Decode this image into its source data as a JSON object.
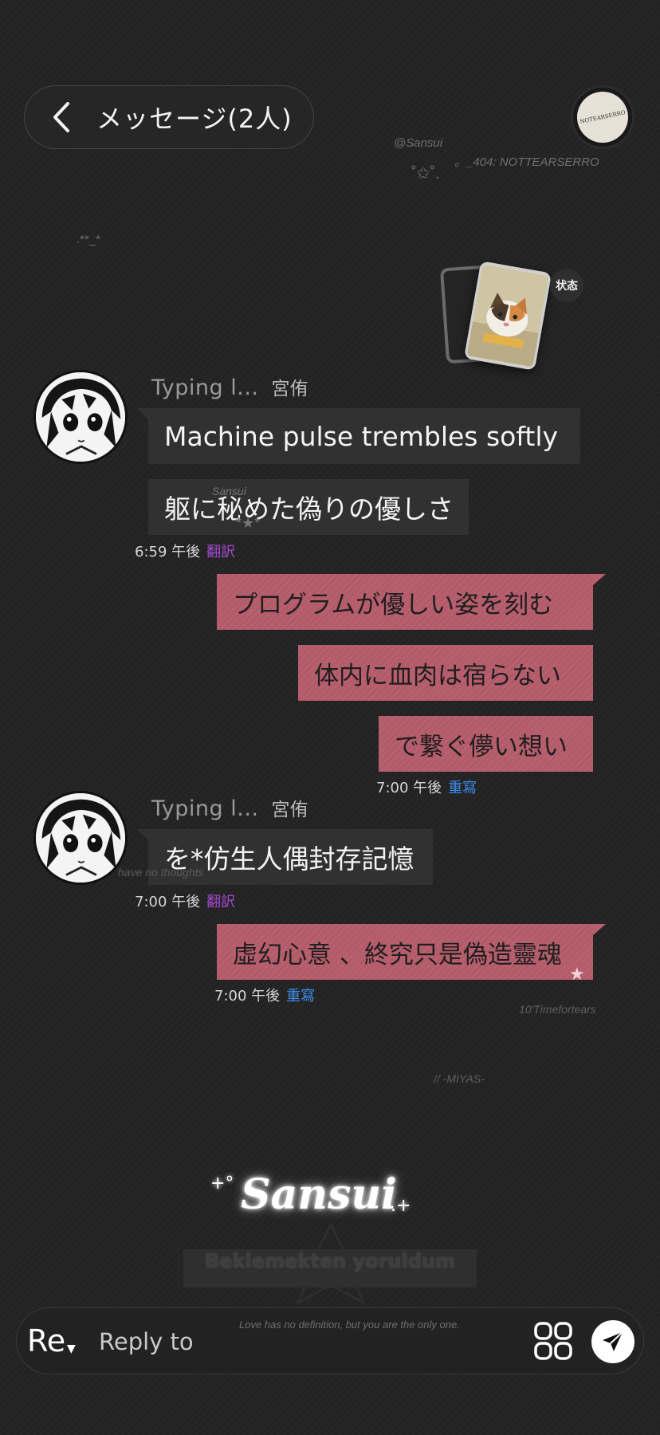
{
  "header": {
    "title": "メッセージ(2人)",
    "avatar_text": "NOTEARSERRO"
  },
  "decorations": {
    "handle_top": "@Sansui",
    "tag_top": "。_404:  NOTTEARSERRO",
    "sparkle_top": "˚✩˚.",
    "dots_left": ".**_*",
    "watermark_mid": "Sansui",
    "watermark_mid_stars": "*★*",
    "have_no_thoughts": "have no thoughts",
    "timeforte": "10'Timefortears",
    "miyas": "//   -MIYAS-"
  },
  "status": {
    "label": "状态"
  },
  "groups": [
    {
      "nickname": "Typing l...",
      "sender": "宮侑",
      "messages": [
        "Machine pulse trembles softly",
        "躯に秘めた偽りの優しさ"
      ],
      "time": "6:59 午後",
      "action": "翻訳"
    },
    {
      "messages": [
        "プログラムが優しい姿を刻む",
        "体内に血肉は宿らない",
        "で繋ぐ儚い想い"
      ],
      "time": "7:00 午後",
      "action": "重寫"
    },
    {
      "nickname": "Typing l...",
      "sender": "宮侑",
      "messages": [
        "を*仿生人偶封存記憶"
      ],
      "time": "7:00 午後",
      "action": "翻訳"
    },
    {
      "messages": [
        "虛幻心意 、終究只是偽造靈魂"
      ],
      "time": "7:00 午後",
      "action": "重寫"
    }
  ],
  "signature": {
    "text": "Sansui",
    "prefix": "+°",
    "suffix": ".+",
    "subtitle": "Beklemekten yoruldum",
    "love": "Love has no definition, but you are the only one."
  },
  "reply": {
    "mode": "Re",
    "placeholder": "Reply to"
  },
  "colors": {
    "background": "#232323",
    "bubble_in": "#313131",
    "bubble_out": "#b85f6e",
    "translate": "#a74ad3",
    "rewrite": "#3d8df0"
  }
}
